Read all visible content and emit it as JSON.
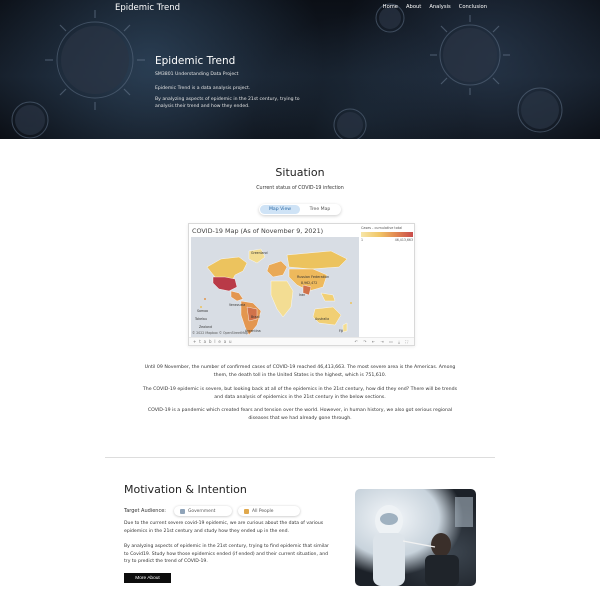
{
  "nav": {
    "brand": "Epidemic Trend",
    "links": [
      "Home",
      "About",
      "Analysis",
      "Conclusion"
    ]
  },
  "hero": {
    "title": "Epidemic Trend",
    "subtitle": "SM3801 Understanding Data Project",
    "p1": "Epidemic Trend is a data analysis project.",
    "p2": "By analyzing aspects of epidemic in the 21st century, trying to analysis their trend and how they ended."
  },
  "situation": {
    "title": "Situation",
    "subtitle": "Current status of COVID-19 infection",
    "toggle": {
      "options": [
        "Map View",
        "Tree Map"
      ],
      "selected": "Map View"
    },
    "map": {
      "title": "COVID-19 Map (As of November 9, 2021)",
      "legend_title": "Cases - cumulative total",
      "legend_min": "1",
      "legend_max": "46,413,663",
      "credit": "© 2022 Mapbox © OpenStreetMap",
      "logo": "+ t a b l e a u",
      "labels": [
        "Greenland",
        "Russian Federation",
        "8,962,472",
        "Iran",
        "Venezuela",
        "Brazil",
        "Argentina",
        "Samoa",
        "Tokelau",
        "Zealand",
        "Australia",
        "Fiji"
      ]
    },
    "paragraphs": [
      "Until 09 November, the number of confirmed cases of COVID-19 reached 46,413,663. The most severe area is the Americas. Among them, the death toll in the United States is the highest, which is 751,610.",
      "The COVID-19 epidemic is severe, but looking back at all of the epidemics in the 21st century, how did they end? There will be trends and data analysis of epidemics in the 21st century in the below sections.",
      "COVID-19 is a pandemic which created fears and tension over the world. However, in human history, we also got serious regional diseases that we had already gone through."
    ]
  },
  "motivation": {
    "title": "Motivation & Intention",
    "audience_label": "Target Audience:",
    "chips": [
      "Government",
      "All People"
    ],
    "p1": "Due to the current severe covid-19 epidemic, we are curious about the data of various epidemics in the 21st century and study how they ended up in the end.",
    "p2": "By analyzing aspects of epidemic in the 21st century, trying to find epidemic that similar to Covid19. Study how those epidemics ended (if ended) and their current situation, and try to predict the trend of COVID-19.",
    "button": "More About"
  },
  "colors": {
    "hero_bg": "#0b0f16",
    "toggle_active": "#cfe3f6",
    "map_low": "#f7e6a8",
    "map_high": "#c94b4b",
    "button_bg": "#0d0d0d"
  }
}
